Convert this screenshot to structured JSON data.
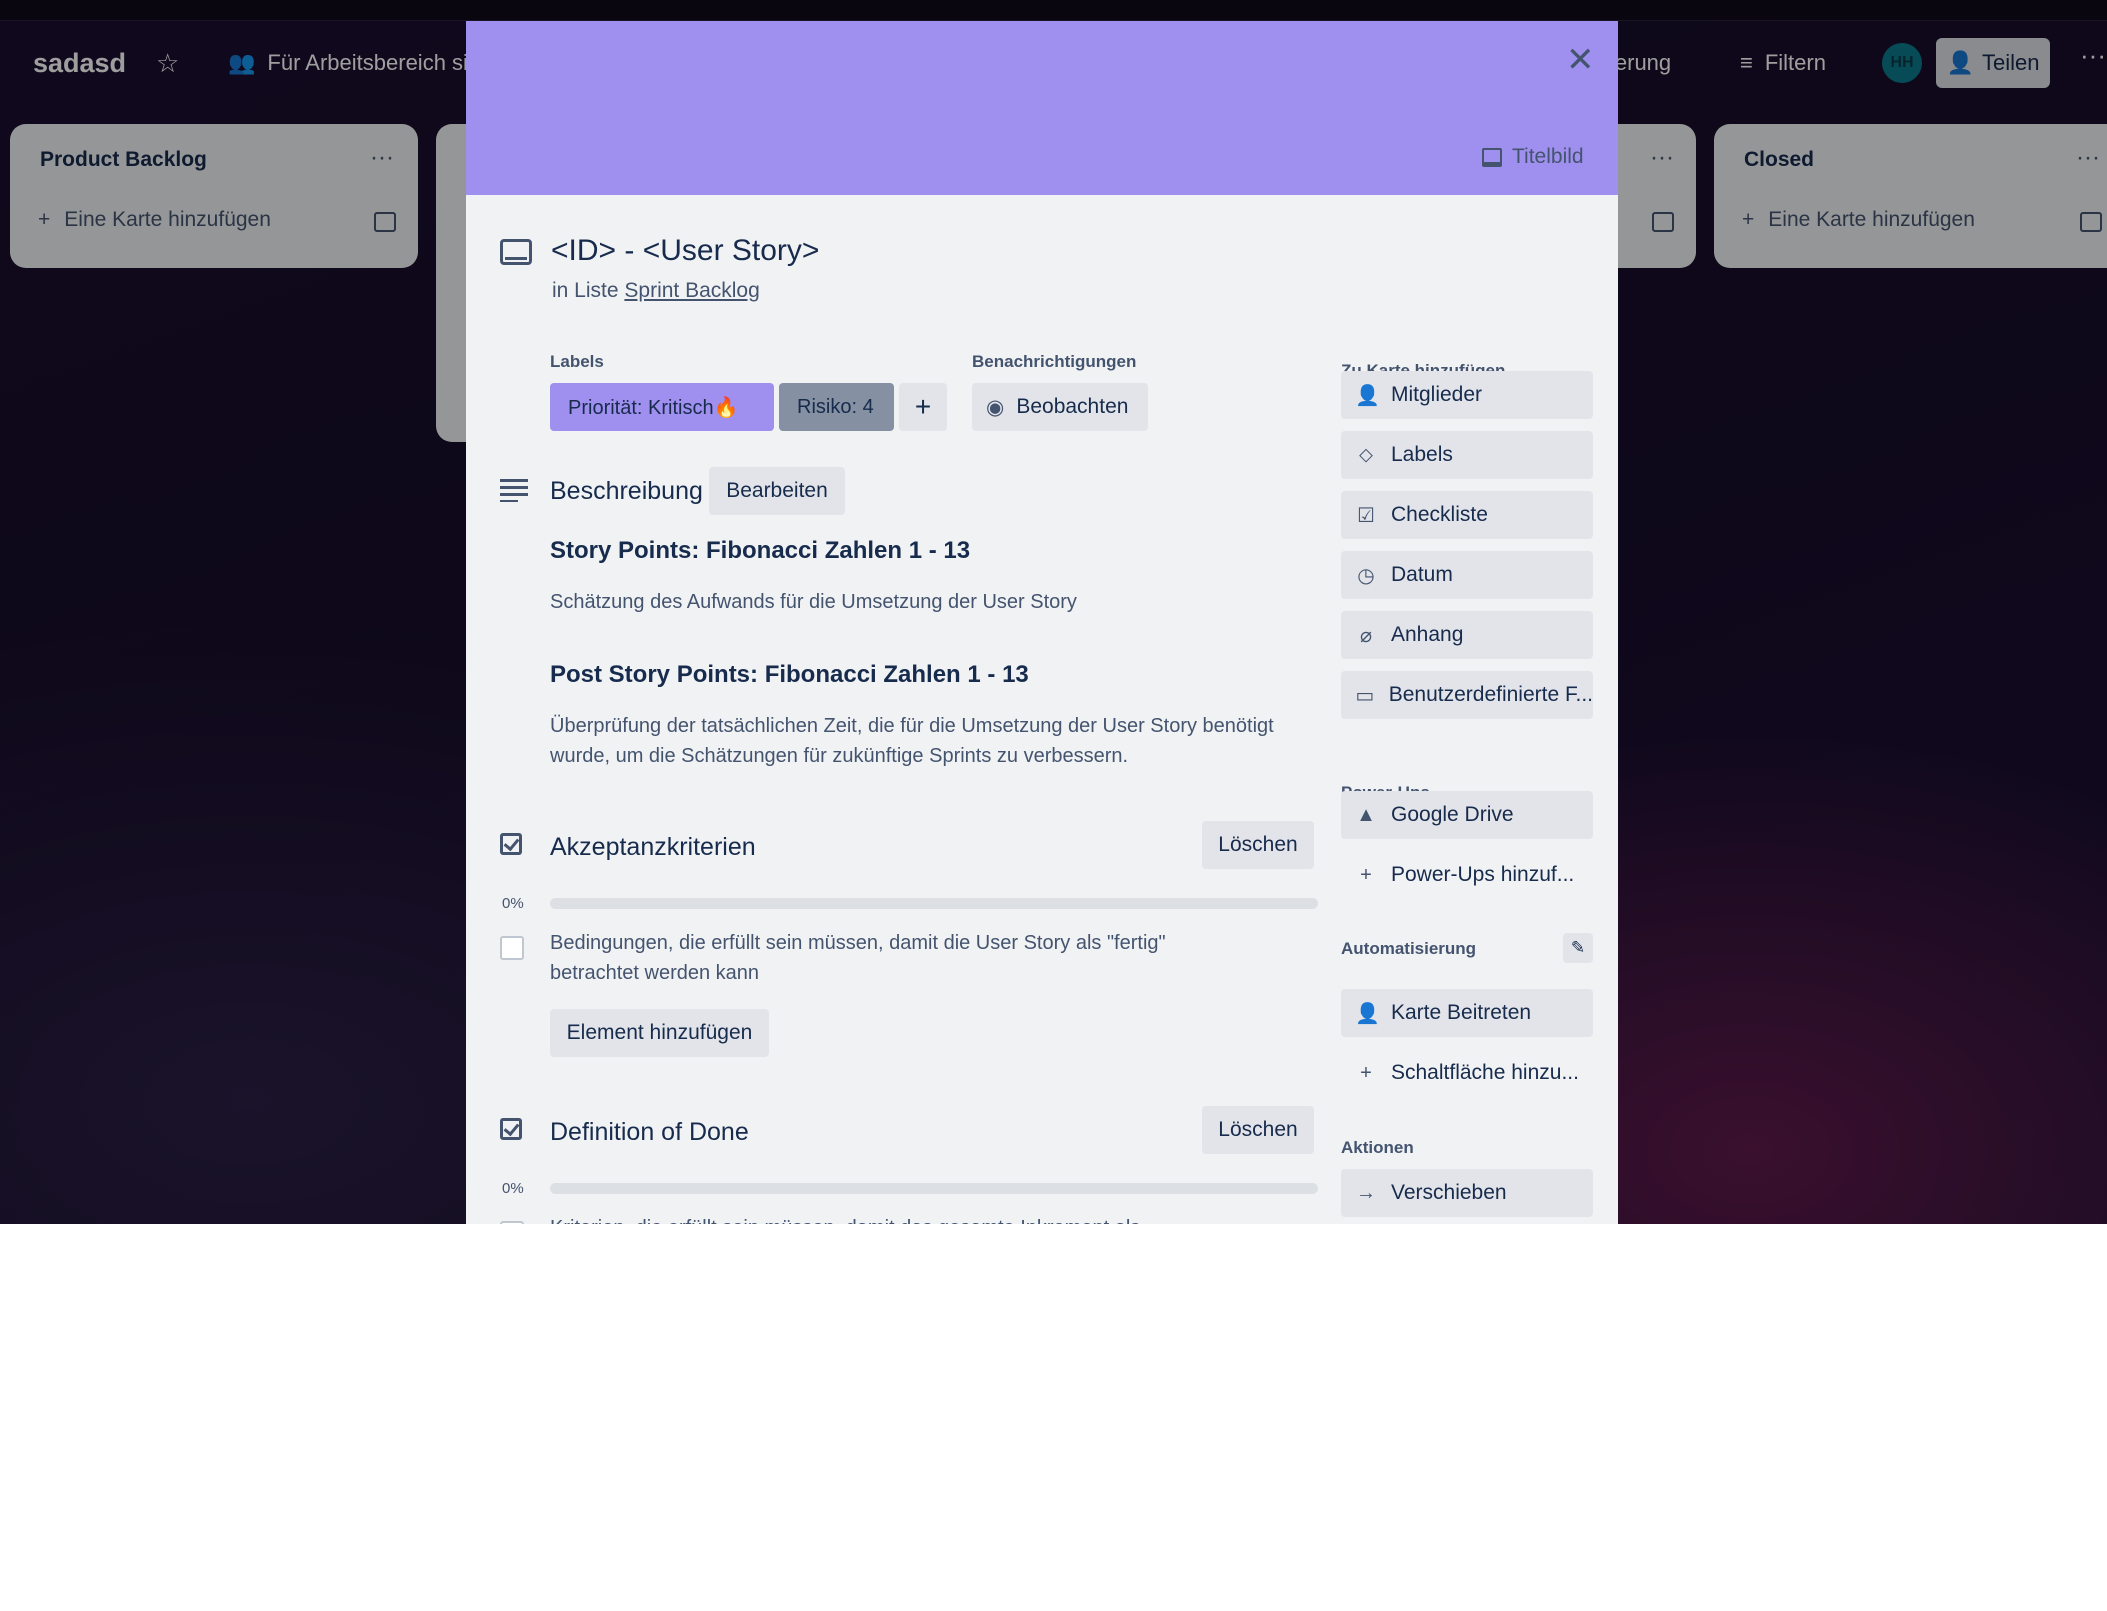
{
  "board": {
    "title": "sadasd",
    "visibility_label": "Für Arbeitsbereich sic",
    "automation_partial": "ierung",
    "filter_label": "Filtern",
    "avatar_initials": "HH",
    "share_label": "Teilen",
    "lists": [
      {
        "title": "Product Backlog",
        "add_card": "Eine Karte hinzufügen"
      },
      {
        "title": "Closed",
        "add_card": "Eine Karte hinzufügen"
      }
    ]
  },
  "card": {
    "cover_button": "Titelbild",
    "title": "<ID> - <User Story>",
    "in_list_prefix": "in Liste",
    "list_name": "Sprint Backlog",
    "labels_heading": "Labels",
    "labels": [
      {
        "text": "Priorität: Kritisch🔥",
        "color": "#9f8fef"
      },
      {
        "text": "Risiko: 4",
        "color": "#8590a2"
      }
    ],
    "add_label": "+",
    "notifications_heading": "Benachrichtigungen",
    "watch_label": "Beobachten",
    "description": {
      "heading": "Beschreibung",
      "edit_label": "Bearbeiten",
      "blocks": [
        {
          "heading": "Story Points: Fibonacci Zahlen 1 - 13",
          "text": "Schätzung des Aufwands für die Umsetzung der User Story"
        },
        {
          "heading": "Post Story Points: Fibonacci Zahlen 1 - 13",
          "text": "Überprüfung der tatsächlichen Zeit, die für die Umsetzung der User Story benötigt wurde, um die Schätzungen für zukünftige Sprints zu verbessern."
        }
      ]
    },
    "checklists": [
      {
        "title": "Akzeptanzkriterien",
        "delete_label": "Löschen",
        "progress_text": "0%",
        "progress": 0,
        "items": [
          "Bedingungen, die erfüllt sein müssen, damit die User Story als \"fertig\" betrachtet werden kann"
        ],
        "add_item_label": "Element hinzufügen"
      },
      {
        "title": "Definition of Done",
        "delete_label": "Löschen",
        "progress_text": "0%",
        "progress": 0,
        "items": [
          "Kriterien, die erfüllt sein müssen, damit das gesamte Inkrement als"
        ]
      }
    ]
  },
  "sidebar": {
    "add_heading": "Zu Karte hinzufügen",
    "add_items": [
      {
        "label": "Mitglieder",
        "icon": "person-icon"
      },
      {
        "label": "Labels",
        "icon": "tag-icon"
      },
      {
        "label": "Checkliste",
        "icon": "checklist-icon"
      },
      {
        "label": "Datum",
        "icon": "clock-icon"
      },
      {
        "label": "Anhang",
        "icon": "paperclip-icon"
      },
      {
        "label": "Benutzerdefinierte F...",
        "icon": "custom-fields-icon"
      }
    ],
    "powerups_heading": "Power-Ups",
    "google_drive": "Google Drive",
    "add_powerups": "Power-Ups hinzuf...",
    "automation_heading": "Automatisierung",
    "join_card": "Karte Beitreten",
    "add_button": "Schaltfläche hinzu...",
    "actions_heading": "Aktionen",
    "move": "Verschieben"
  },
  "colors": {
    "cover": "#9f8fef",
    "modal_bg": "#f1f2f4",
    "text": "#172b4d",
    "muted": "#44546f"
  }
}
